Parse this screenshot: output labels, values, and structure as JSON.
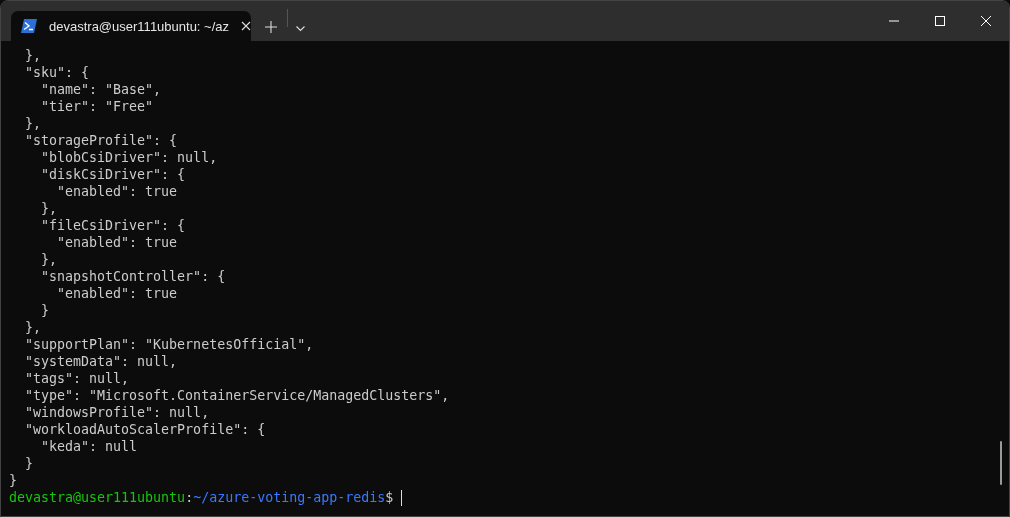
{
  "tab": {
    "title": "devastra@user111ubuntu: ~/az",
    "selected": true
  },
  "terminal": {
    "lines": [
      "  },",
      "  \"sku\": {",
      "    \"name\": \"Base\",",
      "    \"tier\": \"Free\"",
      "  },",
      "  \"storageProfile\": {",
      "    \"blobCsiDriver\": null,",
      "    \"diskCsiDriver\": {",
      "      \"enabled\": true",
      "    },",
      "    \"fileCsiDriver\": {",
      "      \"enabled\": true",
      "    },",
      "    \"snapshotController\": {",
      "      \"enabled\": true",
      "    }",
      "  },",
      "  \"supportPlan\": \"KubernetesOfficial\",",
      "  \"systemData\": null,",
      "  \"tags\": null,",
      "  \"type\": \"Microsoft.ContainerService/ManagedClusters\",",
      "  \"windowsProfile\": null,",
      "  \"workloadAutoScalerProfile\": {",
      "    \"keda\": null",
      "  }",
      "}"
    ],
    "prompt": {
      "user": "devastra@user111ubuntu",
      "separator": ":",
      "path": "~/azure-voting-app-redis",
      "symbol": "$ "
    }
  }
}
